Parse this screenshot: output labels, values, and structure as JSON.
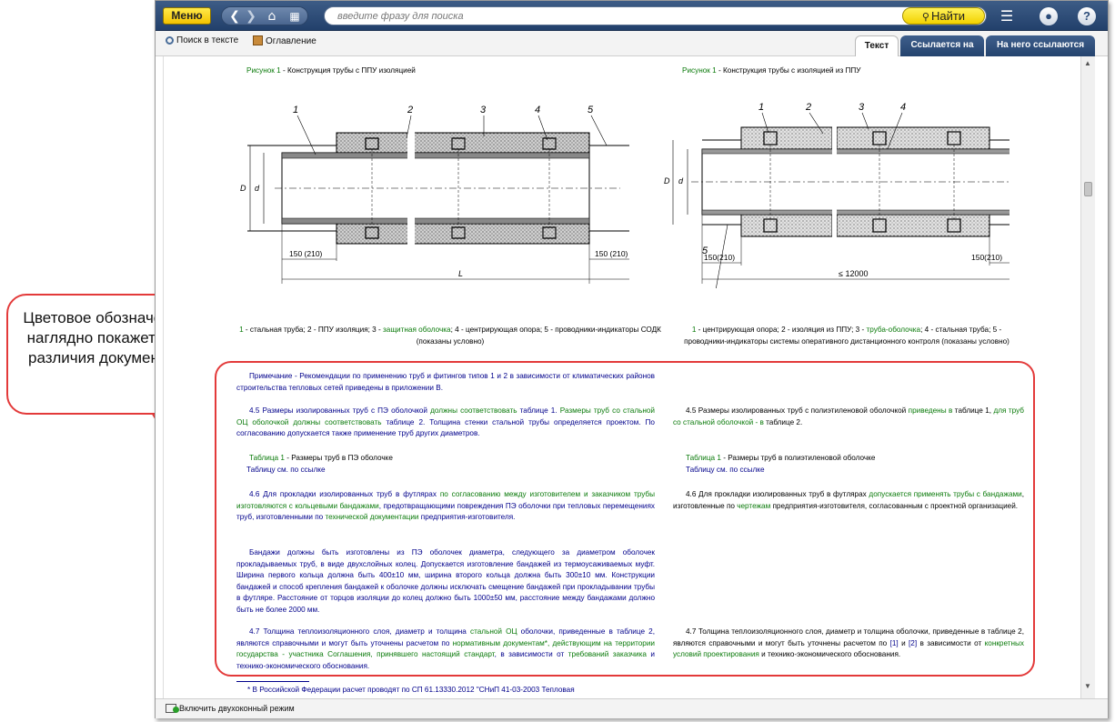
{
  "toolbar": {
    "menu_label": "Меню",
    "search_placeholder": "введите фразу для поиска",
    "find_label": "Найти"
  },
  "icons": [
    "back-icon",
    "forward-icon",
    "home-icon",
    "grid-icon",
    "magnifier-icon",
    "hamburger-icon",
    "user-icon",
    "help-icon"
  ],
  "subtoolbar": {
    "search_in_text": "Поиск в тексте",
    "contents": "Оглавление"
  },
  "tabs": [
    {
      "label": "Текст",
      "active": true
    },
    {
      "label": "Ссылается на",
      "active": false
    },
    {
      "label": "На него ссылаются",
      "active": false
    }
  ],
  "left": {
    "figure_caption_num": "Рисунок 1",
    "figure_caption_text": " - Конструкция трубы с ППУ изоляцией",
    "callouts": [
      "1",
      "2",
      "3",
      "4",
      "5"
    ],
    "dims": [
      "150 (210)",
      "150 (210)",
      "L",
      "D",
      "d"
    ],
    "legend_1": "1",
    "legend_a": " - стальная труба; 2 - ППУ изоляция; 3 - ",
    "legend_b": "защитная оболочка",
    "legend_c": "; 4 - центрирующая опора; 5 - проводники-индикаторы СОДК (показаны условно)",
    "note": "Примечание - Рекомендации по применению труб и фитингов типов 1 и 2 в зависимости от климатических районов строительства тепловых сетей приведены в приложении В.",
    "p45_a": "4.5 Размеры изолированных труб с ПЭ оболочкой ",
    "p45_b": "должны соответствовать",
    "p45_c": " таблице 1. ",
    "p45_d": "Размеры труб со стальной ОЦ оболочкой должны соответствовать",
    "p45_e": " таблице 2. Толщина стенки стальной трубы определяется проектом. По согласованию допускается также применение труб других диаметров.",
    "table_title_a": "Таблица 1",
    "table_title_b": " - Размеры труб в ПЭ оболочке",
    "table_ref": "Таблицу см. по ссылке",
    "p46_a": "4.6 Для прокладки изолированных труб в футлярах ",
    "p46_b": "по согласованию между изготовителем и заказчиком",
    "p46_c": " ",
    "p46_d": "трубы изготовляются с кольцевыми бандажами",
    "p46_e": ", предотвращающими повреждения ПЭ оболочки при тепловых перемещениях труб, изготовленными по ",
    "p46_f": "технической документации",
    "p46_g": " предприятия-изготовителя.",
    "p_band": "Бандажи должны быть изготовлены из ПЭ оболочек диаметра, следующего за диаметром оболочек прокладываемых труб, в виде двухслойных колец. Допускается изготовление бандажей из термоусаживаемых муфт. Ширина первого кольца должна быть 400±10 мм, ширина второго кольца должна быть 300±10 мм. Конструкции бандажей и способ крепления бандажей к оболочке должны исключать смещение бандажей при прокладывании трубы в футляре. Расстояние от торцов изоляции до колец должно быть 1000±50 мм, расстояние между бандажами должно быть не более 2000 мм.",
    "p47_a": "4.7 Толщина теплоизоляционного слоя, диаметр и толщина ",
    "p47_b": "стальной ОЦ",
    "p47_c": " оболочки, приведенные в таблице 2, являются справочными и могут быть уточнены расчетом по ",
    "p47_d": "нормативным документам*, действующим на территории государства - участника Соглашения, принявшего настоящий стандарт",
    "p47_e": ", в зависимости от ",
    "p47_f": "требований заказчика",
    "p47_g": " и технико-экономического обоснования.",
    "footnote": "* В Российской Федерации расчет проводят по СП 61.13330.2012 \"СНиП 41-03-2003 Тепловая"
  },
  "right": {
    "figure_caption_num": "Рисунок 1",
    "figure_caption_text": " - Конструкция трубы с изоляцией из ППУ",
    "callouts": [
      "1",
      "2",
      "3",
      "4",
      "5"
    ],
    "dims": [
      "150(210)",
      "150(210)",
      "≤ 12000",
      "D",
      "d"
    ],
    "legend_1": "1",
    "legend_a": " - центрирующая опора; 2 - изоляция из ППУ; 3 - ",
    "legend_b": "труба-оболочка",
    "legend_c": "; 4 - стальная труба; 5 - проводники-индикаторы системы оперативного дистанционного контроля (показаны условно)",
    "p45_a": "4.5 Размеры изолированных труб с полиэтиленовой оболочкой ",
    "p45_b": "приведены в",
    "p45_c": " таблице 1, ",
    "p45_d": "для труб со стальной оболочкой - в",
    "p45_e": " таблице 2.",
    "table_title_a": "Таблица 1",
    "table_title_b": " - Размеры труб в полиэтиленовой оболочке",
    "table_ref": "Таблицу см. по ссылке",
    "p46_a": "4.6 Для прокладки изолированных труб в футлярах ",
    "p46_b": "допускается применять трубы с бандажами",
    "p46_c": ", изготовленные по ",
    "p46_d": "чертежам",
    "p46_e": " предприятия-изготовителя, согласованным с проектной организацией.",
    "p47_a": "4.7 Толщина теплоизоляционного слоя, диаметр и толщина оболочки, приведенные в таблице 2, являются справочными и могут быть уточнены расчетом по ",
    "p47_b": "[1]",
    "p47_c": " и ",
    "p47_d": "[2]",
    "p47_e": " в зависимости от ",
    "p47_f": "конкретных условий проектирования",
    "p47_g": " и технико-экономического обоснования."
  },
  "status": {
    "toggle_label": "Включить двухоконный режим"
  },
  "callout": {
    "text": "Цветовое обозначение наглядно покажет все различия документов"
  }
}
